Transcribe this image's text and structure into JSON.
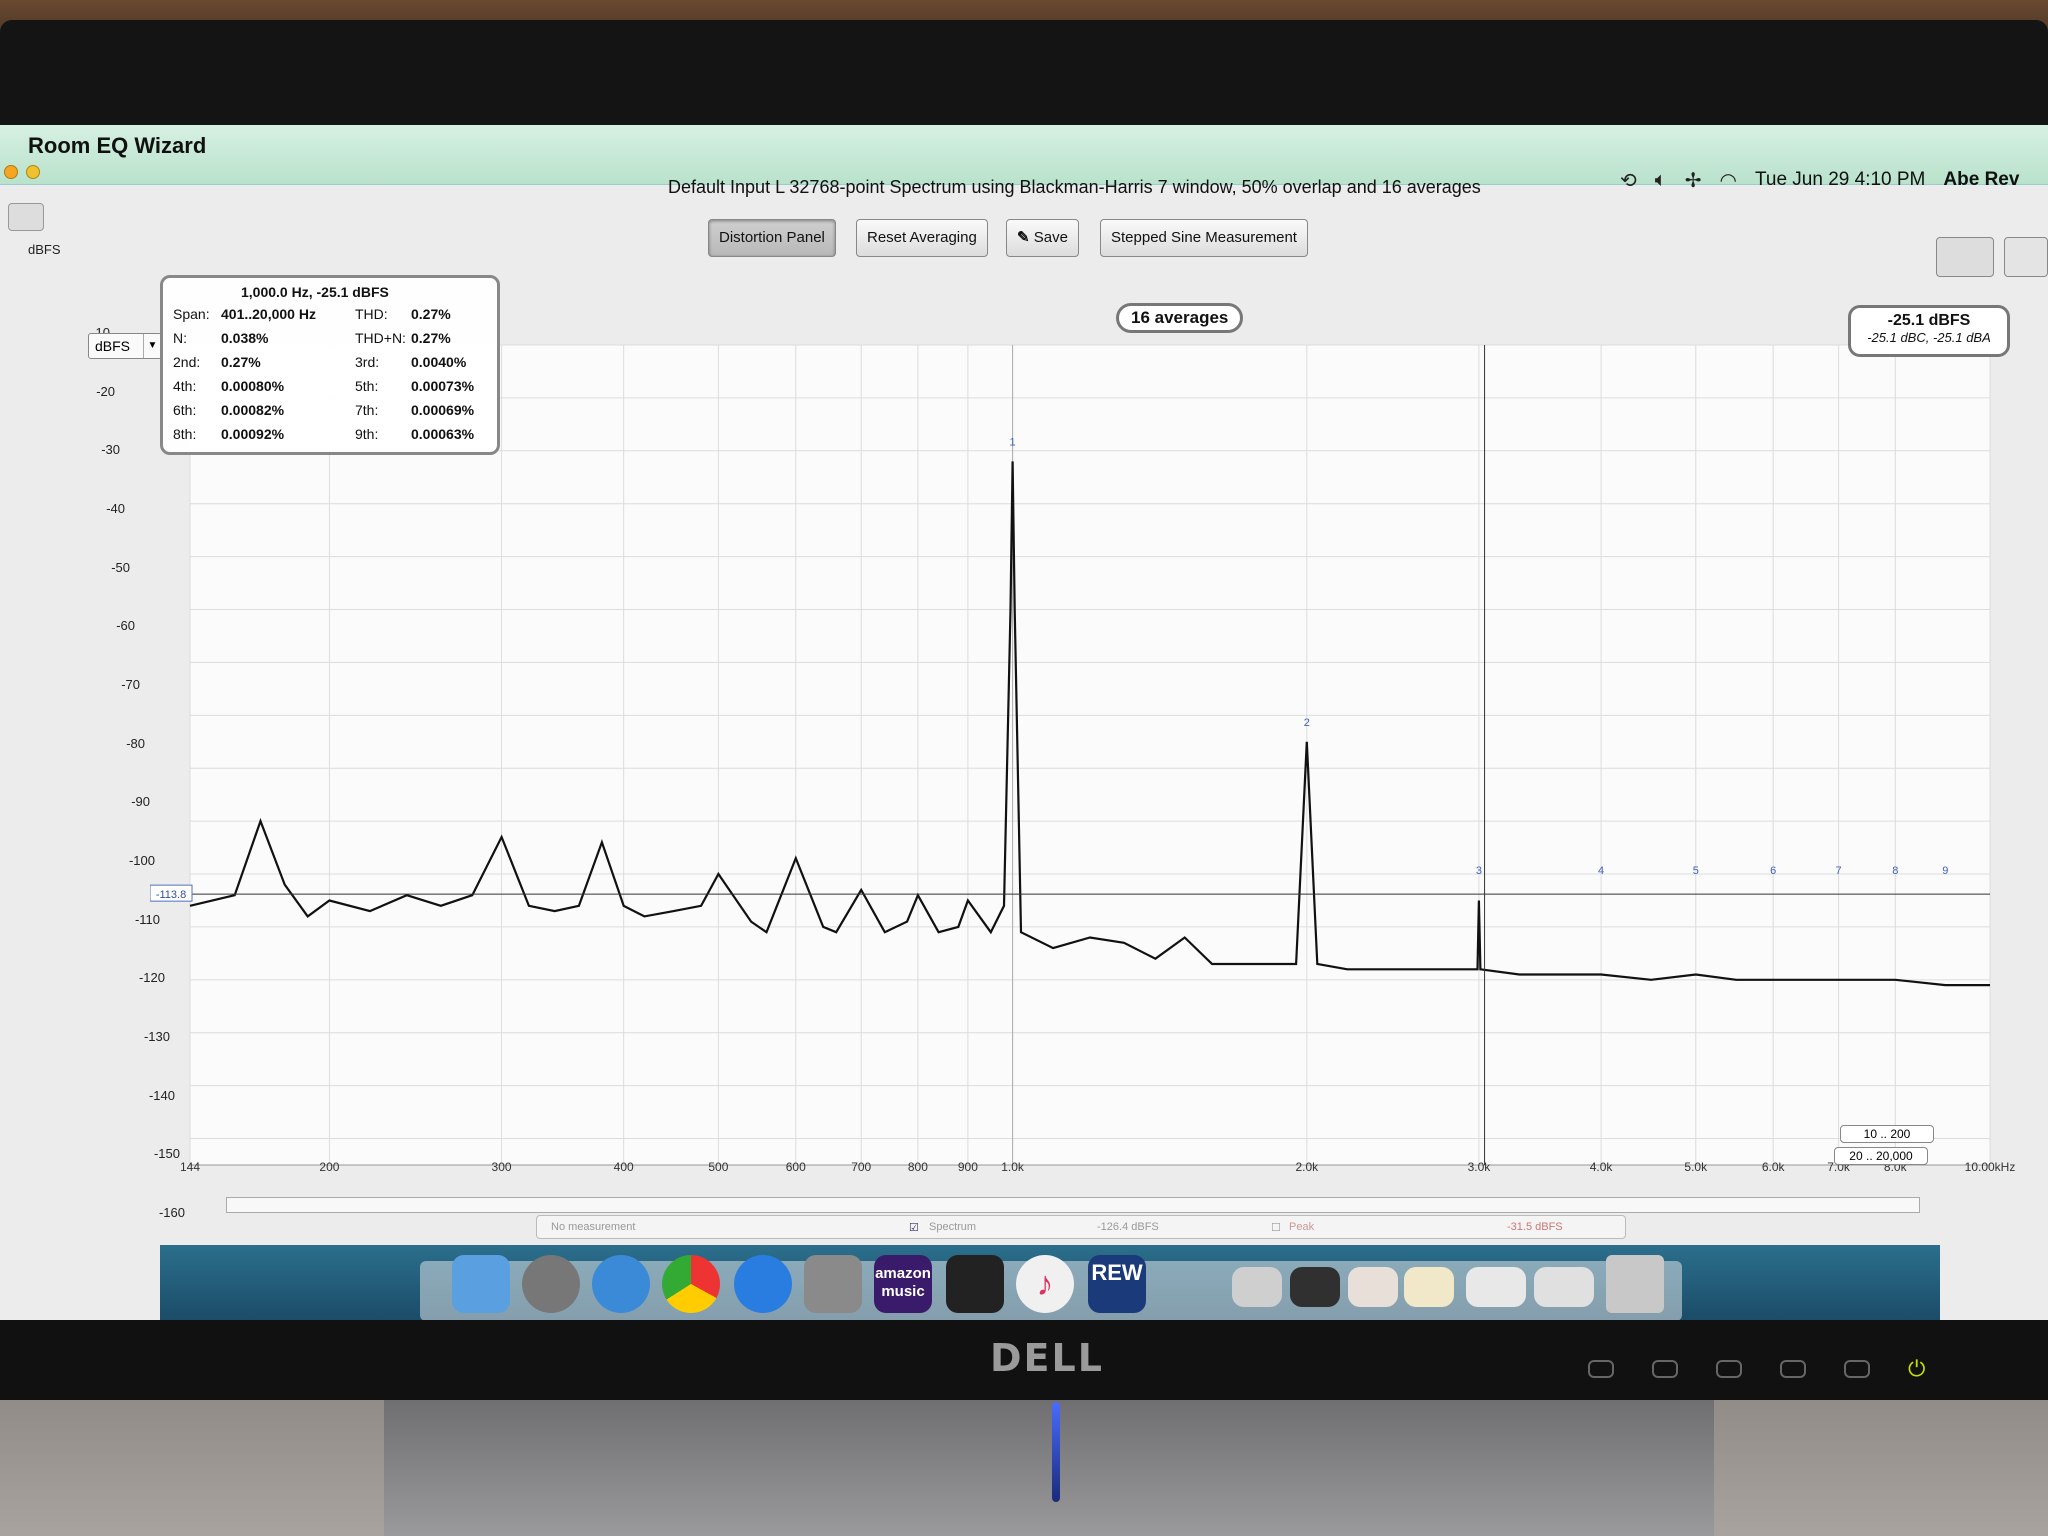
{
  "menubar": {
    "app_name": "Room EQ Wizard",
    "status_time": "Tue Jun 29  4:10 PM",
    "user": "Abe Rev"
  },
  "window": {
    "title": "Default Input L 32768-point Spectrum using Blackman-Harris 7 window, 50% overlap and 16 averages"
  },
  "toolbar": {
    "distortion_panel": "Distortion Panel",
    "reset_averaging": "Reset Averaging",
    "save": "Save",
    "stepped_sine": "Stepped Sine Measurement"
  },
  "yaxis": {
    "unit_label": "dBFS",
    "unit_select": "dBFS",
    "ticks": [
      "-10",
      "-20",
      "-30",
      "-40",
      "-50",
      "-60",
      "-70",
      "-80",
      "-90",
      "-100",
      "-110",
      "-120",
      "-130",
      "-140",
      "-150",
      "-160"
    ],
    "cursor_value": "-113.8"
  },
  "xaxis": {
    "ticks": [
      "144",
      "200",
      "300",
      "400",
      "500",
      "600",
      "700",
      "800",
      "900",
      "1.0k",
      "2.0k",
      "3.0k",
      "4.0k",
      "5.0k",
      "6.0k",
      "7.0k",
      "8.0k",
      "10.00kHz"
    ]
  },
  "distortion": {
    "header": "1,000.0 Hz, -25.1 dBFS",
    "rows": [
      {
        "label": "Span:",
        "value": "401..20,000 Hz",
        "label2": "THD:",
        "value2": "0.27%"
      },
      {
        "label": "N:",
        "value": "0.038%",
        "label2": "THD+N:",
        "value2": "0.27%"
      },
      {
        "label": "2nd:",
        "value": "0.27%",
        "label2": "3rd:",
        "value2": "0.0040%"
      },
      {
        "label": "4th:",
        "value": "0.00080%",
        "label2": "5th:",
        "value2": "0.00073%"
      },
      {
        "label": "6th:",
        "value": "0.00082%",
        "label2": "7th:",
        "value2": "0.00069%"
      },
      {
        "label": "8th:",
        "value": "0.00092%",
        "label2": "9th:",
        "value2": "0.00063%"
      }
    ]
  },
  "averages_label": "16 averages",
  "level": {
    "main": "-25.1 dBFS",
    "sub": "-25.1 dBC, -25.1 dBA"
  },
  "ranges": [
    "10 .. 200",
    "20 .. 20,000"
  ],
  "legend": {
    "no_measurement": "No measurement",
    "spectrum": "Spectrum",
    "spectrum_level": "-126.4 dBFS",
    "peak": "Peak",
    "peak_level": "-31.5 dBFS"
  },
  "dock": {
    "amazon_music": "amazon music",
    "rew": "REW"
  },
  "bezel": {
    "brand": "DELL"
  },
  "chart_data": {
    "type": "line",
    "title": "",
    "xlabel": "",
    "ylabel": "dBFS",
    "x_scale": "log",
    "xlim": [
      144,
      10000
    ],
    "ylim": [
      -165,
      -10
    ],
    "grid": true,
    "series": [
      {
        "values_x": [
          144,
          160,
          170,
          180,
          190,
          200,
          220,
          240,
          260,
          280,
          300,
          320,
          340,
          360,
          380,
          400,
          420,
          450,
          480,
          500,
          540,
          560,
          600,
          640,
          660,
          700,
          740,
          780,
          800,
          840,
          880,
          900,
          950,
          980,
          995,
          1000,
          1005,
          1020,
          1100,
          1200,
          1300,
          1400,
          1500,
          1600,
          1800,
          1950,
          2000,
          2050,
          2200,
          2500,
          2800,
          2990,
          3000,
          3010,
          3300,
          3600,
          4000,
          4500,
          5000,
          5500,
          6000,
          7000,
          8000,
          9000,
          10000
        ],
        "values_y": [
          -116,
          -114,
          -100,
          -112,
          -118,
          -115,
          -117,
          -114,
          -116,
          -114,
          -103,
          -116,
          -117,
          -116,
          -104,
          -116,
          -118,
          -117,
          -116,
          -110,
          -119,
          -121,
          -107,
          -120,
          -121,
          -113,
          -121,
          -119,
          -114,
          -121,
          -120,
          -115,
          -121,
          -116,
          -60,
          -32,
          -60,
          -121,
          -124,
          -122,
          -123,
          -126,
          -122,
          -127,
          -127,
          -127,
          -85,
          -127,
          -128,
          -128,
          -128,
          -128,
          -115,
          -128,
          -129,
          -129,
          -129,
          -130,
          -129,
          -130,
          -130,
          -130,
          -130,
          -131,
          -131
        ]
      }
    ],
    "harmonic_markers": [
      "1",
      "2",
      "3",
      "4",
      "5",
      "6",
      "7",
      "8",
      "9"
    ],
    "harmonic_freqs": [
      1000,
      2000,
      3000,
      4000,
      5000,
      6000,
      7000,
      8000,
      9000
    ],
    "cursor": {
      "x": 3040,
      "y": -113.8
    }
  }
}
